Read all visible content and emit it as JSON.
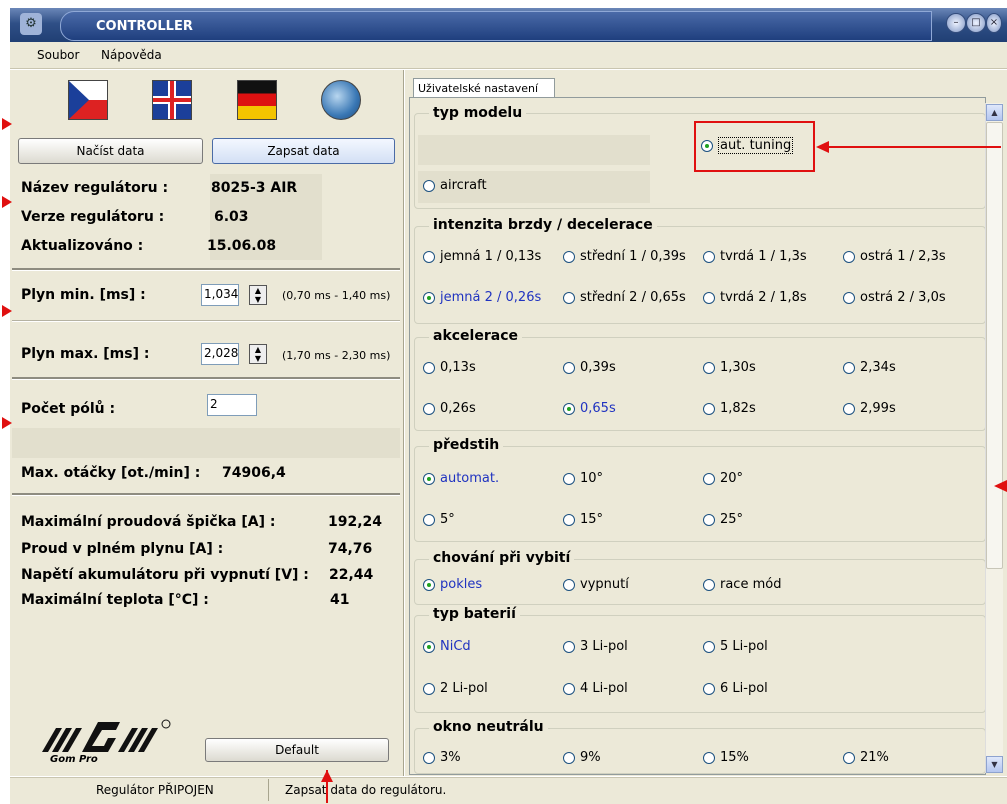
{
  "window": {
    "title": "CONTROLLER"
  },
  "menu": [
    "Soubor",
    "Nápověda"
  ],
  "left": {
    "load_button": "Načíst data",
    "write_button": "Zapsat data",
    "info": [
      {
        "label": "Název regulátoru :",
        "value": "8025-3 AIR"
      },
      {
        "label": "Verze regulátoru :",
        "value": "6.03"
      },
      {
        "label": "Aktualizováno :",
        "value": "15.06.08"
      }
    ],
    "throttle_min": {
      "label": "Plyn min. [ms] :",
      "value": "1,034",
      "range": "(0,70 ms - 1,40 ms)"
    },
    "throttle_max": {
      "label": "Plyn max. [ms] :",
      "value": "2,028",
      "range": "(1,70 ms - 2,30 ms)"
    },
    "poles": {
      "label": "Počet pólů :",
      "value": "2"
    },
    "max_rpm": {
      "label": "Max. otáčky [ot./min] :",
      "value": "74906,4"
    },
    "stats": [
      {
        "label": "Maximální proudová špička [A] :",
        "value": "192,24"
      },
      {
        "label": "Proud v plném plynu [A] :",
        "value": "74,76"
      },
      {
        "label": "Napětí akumulátoru při vypnutí [V] :",
        "value": "22,44"
      },
      {
        "label": "Maximální teplota [°C] :",
        "value": "41"
      }
    ],
    "default_button": "Default",
    "logo_text": "Gom Pro"
  },
  "tab": "Uživatelské nastavení",
  "groups": {
    "model": {
      "title": "typ modelu",
      "options": [
        "aut. tuning",
        "aircraft"
      ]
    },
    "brake": {
      "title": "intenzita brzdy / decelerace",
      "options": [
        "jemná 1 / 0,13s",
        "střední 1 / 0,39s",
        "tvrdá 1 / 1,3s",
        "ostrá 1 / 2,3s",
        "jemná 2  / 0,26s",
        "střední 2 / 0,65s",
        "tvrdá 2 / 1,8s",
        "ostrá 2 / 3,0s"
      ]
    },
    "accel": {
      "title": "akcelerace",
      "options": [
        "0,13s",
        "0,39s",
        "1,30s",
        "2,34s",
        "0,26s",
        "0,65s",
        "1,82s",
        "2,99s"
      ]
    },
    "timing": {
      "title": "předstih",
      "options": [
        "automat.",
        "10°",
        "20°",
        "5°",
        "15°",
        "25°"
      ]
    },
    "cutoff": {
      "title": "chování při vybití",
      "options": [
        "pokles",
        "vypnutí",
        "race mód"
      ]
    },
    "battery": {
      "title": "typ baterií",
      "options": [
        "NiCd",
        "3 Li-pol",
        "5 Li-pol",
        "2 Li-pol",
        "4 Li-pol",
        "6 Li-pol"
      ]
    },
    "neutral": {
      "title": "okno neutrálu",
      "options": [
        "3%",
        "9%",
        "15%",
        "21%"
      ]
    }
  },
  "status": {
    "connection": "Regulátor PŘIPOJEN",
    "message": "Zapsat data do regulátoru."
  },
  "colors": {
    "accent_red": "#e01010",
    "selected_text": "#2033c0",
    "title_blue": "#1f3f7e"
  }
}
